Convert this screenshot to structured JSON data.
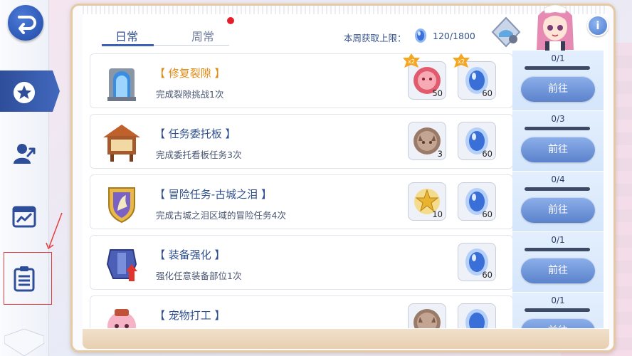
{
  "tabs": [
    {
      "label": "日常",
      "active": true
    },
    {
      "label": "周常",
      "active": false,
      "has_notification": true
    }
  ],
  "weekly_cap": {
    "label": "本周获取上限：",
    "value": "120/1800",
    "icon": "blue-crystal-icon"
  },
  "info_label": "i",
  "sidebar": {
    "items": [
      {
        "name": "back",
        "icon": "back-arrow-icon"
      },
      {
        "name": "favorites",
        "icon": "star-icon",
        "active": true
      },
      {
        "name": "character",
        "icon": "person-arrow-icon"
      },
      {
        "name": "calendar",
        "icon": "calendar-chart-icon"
      },
      {
        "name": "tasks",
        "icon": "clipboard-list-icon",
        "highlighted": true
      }
    ]
  },
  "tasks": [
    {
      "title": "【 修复裂隙 】",
      "title_color": "#e08a12",
      "description": "完成裂隙挑战1次",
      "icon": "portal-gate-icon",
      "rewards": [
        {
          "icon": "pink-token-icon",
          "count": "50",
          "boost": "x2"
        },
        {
          "icon": "blue-crystal-icon",
          "count": "60",
          "boost": "x2"
        }
      ],
      "progress": "0/1",
      "progress_fraction": 0,
      "button_label": "前往"
    },
    {
      "title": "【 任务委托板 】",
      "title_color": "#2f4f8f",
      "description": "完成委托看板任务3次",
      "icon": "notice-board-icon",
      "rewards": [
        {
          "icon": "cat-coin-icon",
          "count": "3"
        },
        {
          "icon": "blue-crystal-icon",
          "count": "60"
        }
      ],
      "progress": "0/3",
      "progress_fraction": 0,
      "button_label": "前往"
    },
    {
      "title": "【 冒险任务-古城之泪 】",
      "title_color": "#2f4f8f",
      "description": "完成古城之泪区域的冒险任务4次",
      "icon": "golden-crest-icon",
      "rewards": [
        {
          "icon": "gold-star-badge-icon",
          "count": "10"
        },
        {
          "icon": "blue-crystal-icon",
          "count": "60"
        }
      ],
      "progress": "0/4",
      "progress_fraction": 0,
      "button_label": "前往"
    },
    {
      "title": "【 装备强化 】",
      "title_color": "#2f4f8f",
      "description": "强化任意装备部位1次",
      "icon": "armor-upgrade-icon",
      "rewards": [
        {
          "icon": "blue-crystal-icon",
          "count": "60"
        }
      ],
      "progress": "0/1",
      "progress_fraction": 0,
      "button_label": "前往"
    },
    {
      "title": "【 宠物打工 】",
      "title_color": "#2f4f8f",
      "description": "",
      "icon": "pet-face-icon",
      "rewards": [
        {
          "icon": "cat-coin-icon",
          "count": ""
        },
        {
          "icon": "blue-crystal-icon",
          "count": ""
        }
      ],
      "progress": "0/1",
      "progress_fraction": 0,
      "button_label": "前往"
    }
  ],
  "colors": {
    "accent": "#3c62b6",
    "title_orange": "#e08a12",
    "notification": "#e61d2c"
  }
}
